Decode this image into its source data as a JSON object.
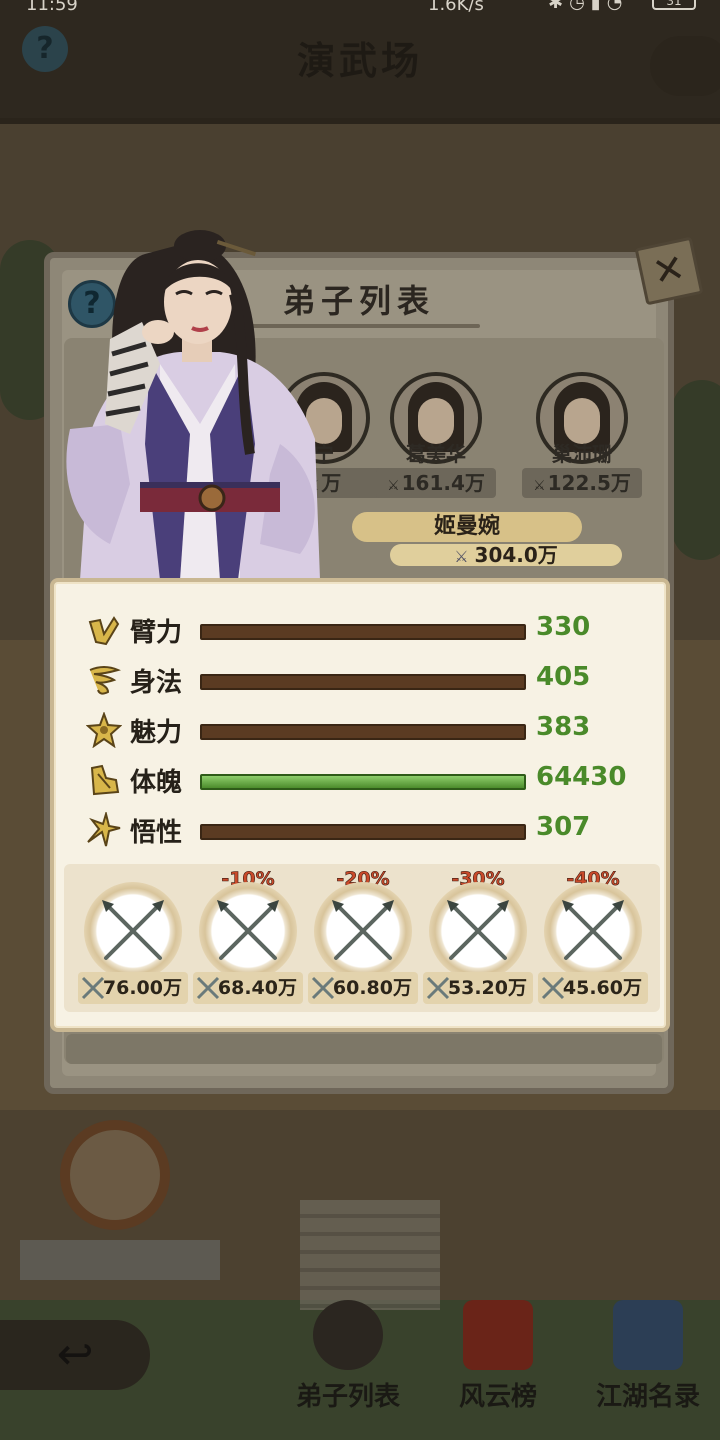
{
  "status_bar": {
    "time": "11:59",
    "network_speed": "1.6K/s",
    "battery": "31"
  },
  "scene": {
    "title": "演武场",
    "help_icon": "?"
  },
  "bottom_nav": {
    "items": [
      {
        "label": "弟子列表",
        "icon": "disciple-avatar-icon"
      },
      {
        "label": "风云榜",
        "icon": "ranking-scroll-icon"
      },
      {
        "label": "江湖名录",
        "icon": "book-icon"
      }
    ],
    "back_icon": "↩"
  },
  "panel": {
    "title": "弟子列表",
    "help_icon": "?",
    "close_icon": "✕",
    "disciples": [
      {
        "name": "宁",
        "power": "万"
      },
      {
        "name": "葛美华",
        "power": "161.4万"
      },
      {
        "name": "巢沛珊",
        "power": "122.5万"
      }
    ],
    "selected": {
      "name": "姬曼婉",
      "power": "304.0万"
    }
  },
  "stats": [
    {
      "name": "臂力",
      "value": "330",
      "icon": "arm-strength-icon",
      "fill": 1.0
    },
    {
      "name": "身法",
      "value": "405",
      "icon": "whirlwind-agility-icon",
      "fill": 1.0
    },
    {
      "name": "魅力",
      "value": "383",
      "icon": "star-flower-charm-icon",
      "fill": 1.0
    },
    {
      "name": "体魄",
      "value": "64430",
      "icon": "constitution-icon",
      "fill": 1.0
    },
    {
      "name": "悟性",
      "value": "307",
      "icon": "sparkle-comprehension-icon",
      "fill": 1.0
    }
  ],
  "weapons": [
    {
      "penalty": "",
      "damage": "76.00万"
    },
    {
      "penalty": "-10%",
      "damage": "68.40万"
    },
    {
      "penalty": "-20%",
      "damage": "60.80万"
    },
    {
      "penalty": "-30%",
      "damage": "53.20万"
    },
    {
      "penalty": "-40%",
      "damage": "45.60万"
    }
  ],
  "colors": {
    "stat_value": "#4a8a2a",
    "penalty": "#c94a2a",
    "bar_brown": "#5b3b22",
    "bar_green": "#4c8c2c",
    "card_bg": "#f7f2e4"
  }
}
